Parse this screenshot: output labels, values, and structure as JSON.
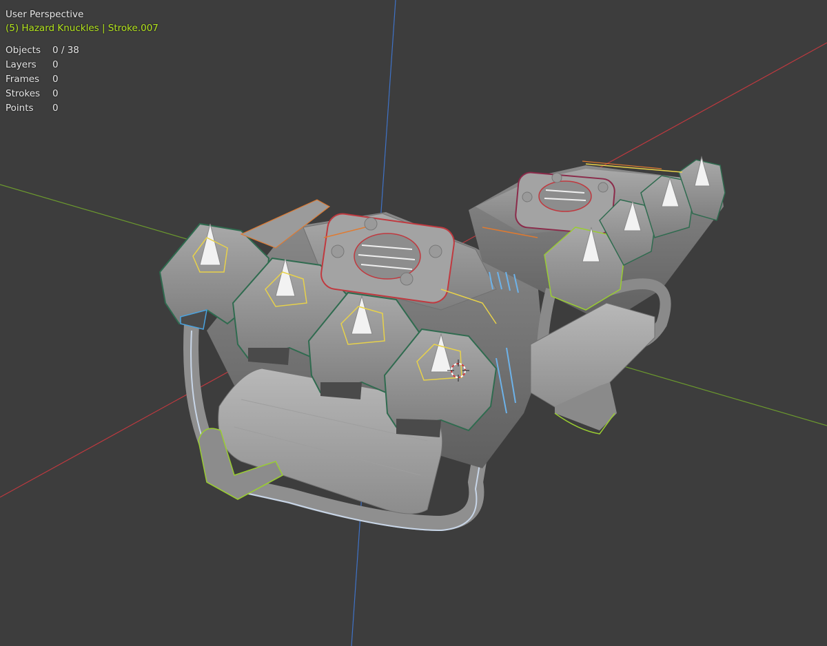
{
  "viewport": {
    "view_name": "User Perspective",
    "active_object": "(5) Hazard Knuckles | Stroke.007",
    "stats": [
      {
        "label": "Objects",
        "value": "0 / 38"
      },
      {
        "label": "Layers",
        "value": "0"
      },
      {
        "label": "Frames",
        "value": "0"
      },
      {
        "label": "Strokes",
        "value": "0"
      },
      {
        "label": "Points",
        "value": "0"
      }
    ]
  },
  "colors": {
    "background": "#3d3d3d",
    "x_axis": "#c0393f",
    "y_axis": "#6c9a2e",
    "z_axis": "#3f73c8",
    "active_text": "#b5e61d"
  },
  "icons": {
    "origin_cursor": "3d-cursor-icon"
  }
}
